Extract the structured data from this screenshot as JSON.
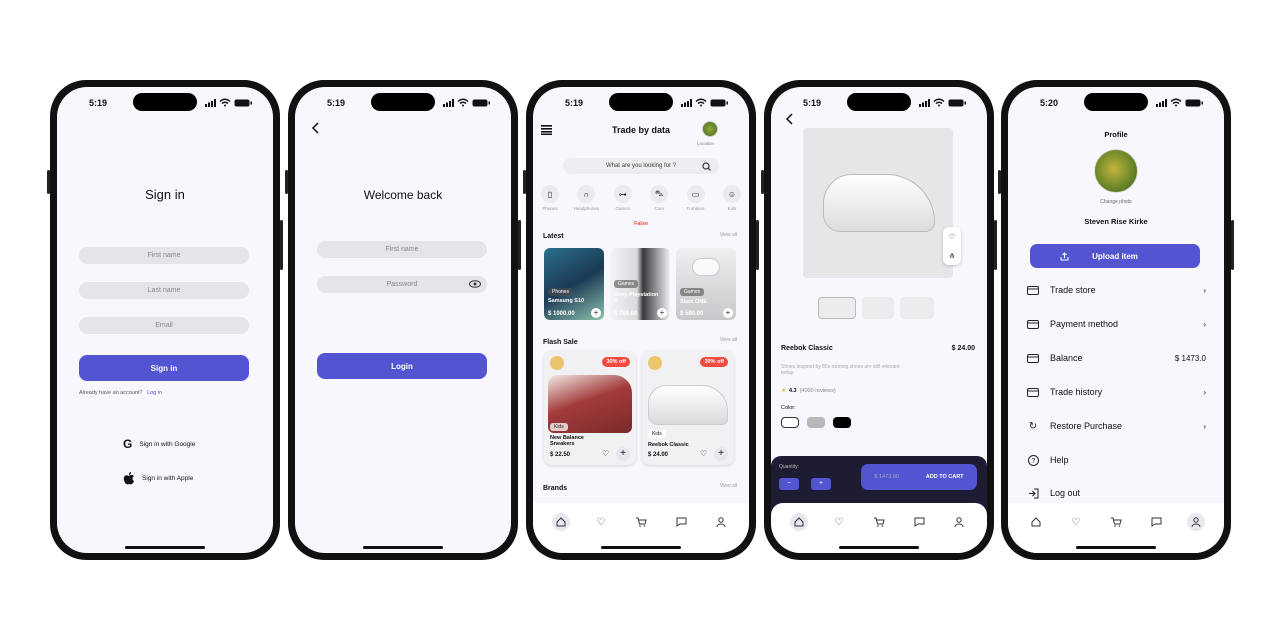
{
  "time": {
    "s1": "5:19",
    "s2": "5:19",
    "s3": "5:19",
    "s4": "5:19",
    "s5": "5:20"
  },
  "signin": {
    "title": "Sign in",
    "first_name": "First name",
    "last_name": "Last name",
    "email": "Email",
    "button": "Sign in",
    "already": "Already have an account?",
    "login_link": "Log in",
    "google": "Sign in with Google",
    "apple": "Sign in with Apple"
  },
  "login": {
    "title": "Welcome back",
    "first_name": "First name",
    "password": "Password",
    "button": "Login"
  },
  "home": {
    "title": "Trade by data",
    "location": "Location",
    "search_placeholder": "What are you looking for ?",
    "categories": [
      "Phones",
      "Headphones",
      "Games",
      "Cars",
      "Furniture",
      "Kids"
    ],
    "error": "False",
    "latest": "Latest",
    "view_all": "View all",
    "latest_items": [
      {
        "tag": "Phones",
        "name": "Samsung S10",
        "price": "$ 1000.00"
      },
      {
        "tag": "Games",
        "name": "Sony Playstation 5",
        "price": "$ 700.00"
      },
      {
        "tag": "Games",
        "name": "Xbox ONE",
        "price": "$ 500.00"
      }
    ],
    "flash": "Flash Sale",
    "flash_items": [
      {
        "discount": "30% off",
        "tag": "Kids",
        "name": "New Balance Sneakers",
        "price": "$ 22.50"
      },
      {
        "discount": "30% off",
        "tag": "Kids",
        "name": "Reebok Classic",
        "price": "$ 24.00"
      }
    ],
    "brands": "Brands"
  },
  "product": {
    "name": "Reebok Classic",
    "price": "$ 24.00",
    "desc": "Shoes inspired by 80s running shoes are still relevant today",
    "rating": "4.3",
    "reviews": "(4000 reviews)",
    "color_label": "Color:",
    "colors": [
      "#ffffff",
      "#b8b8b8",
      "#000000"
    ],
    "quantity": "Quantity:",
    "minus": "−",
    "plus": "+",
    "total": "$ 1473.00",
    "add": "ADD TO CART"
  },
  "profile": {
    "title": "Profile",
    "change_photo": "Change photo",
    "name": "Steven Rise Kirke",
    "upload": "Upload item",
    "rows": [
      {
        "label": "Trade store",
        "value": ""
      },
      {
        "label": "Payment method",
        "value": ""
      },
      {
        "label": "Balance",
        "value": "$ 1473.0"
      },
      {
        "label": "Trade history",
        "value": ""
      },
      {
        "label": "Restore Purchase",
        "value": ""
      },
      {
        "label": "Help",
        "value": ""
      },
      {
        "label": "Log out",
        "value": ""
      }
    ]
  },
  "colors": {
    "accent": "#5254d2",
    "sale": "#ef4c3f",
    "dark_bar": "#1d1c33"
  }
}
